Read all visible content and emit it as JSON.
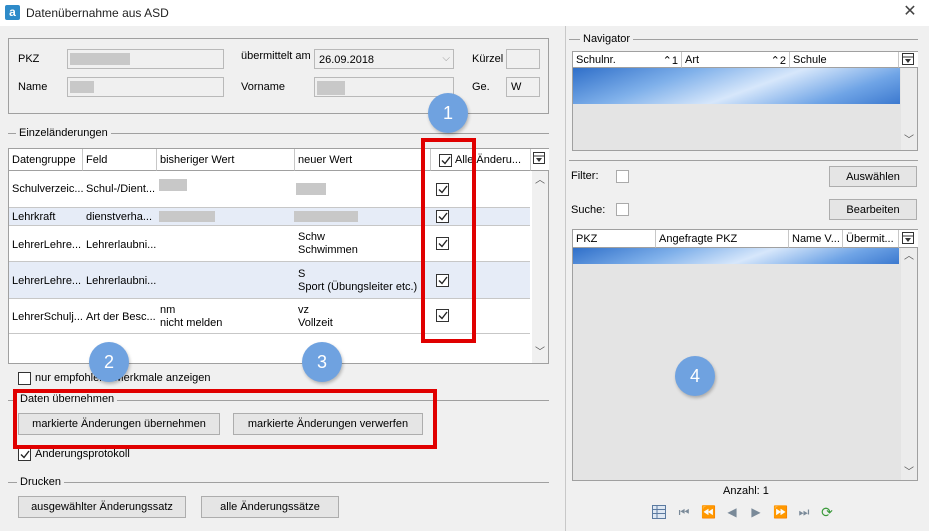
{
  "window": {
    "title": "Datenübernahme aus ASD",
    "app_icon": "a"
  },
  "person": {
    "pkz_label": "PKZ",
    "name_label": "Name",
    "uebermittelt_label": "übermittelt am",
    "uebermittelt_value": "26.09.2018",
    "vorname_label": "Vorname",
    "kuerzel_label": "Kürzel",
    "ge_label": "Ge.",
    "ge_value": "W"
  },
  "einzel": {
    "section_label": "Einzeländerungen",
    "columns": [
      "Datengruppe",
      "Feld",
      "bisheriger Wert",
      "neuer Wert",
      "Alle Änderu..."
    ],
    "rows": [
      {
        "gruppe": "Schulverzeic...",
        "feld": "Schul-/Dient...",
        "bisher1": "",
        "bisher2": "",
        "neu1": "",
        "neu2": "",
        "checked": true
      },
      {
        "gruppe": "Lehrkraft",
        "feld": "dienstverha...",
        "bisher1": "",
        "bisher2": "",
        "neu1": "",
        "neu2": "",
        "checked": true
      },
      {
        "gruppe": "LehrerLehre...",
        "feld": "Lehrerlaubni...",
        "bisher1": "",
        "bisher2": "",
        "neu1": "Schw",
        "neu2": "Schwimmen",
        "checked": true
      },
      {
        "gruppe": "LehrerLehre...",
        "feld": "Lehrerlaubni...",
        "bisher1": "",
        "bisher2": "",
        "neu1": "S",
        "neu2": "Sport (Übungsleiter etc.)",
        "checked": true
      },
      {
        "gruppe": "LehrerSchulj...",
        "feld": "Art der Besc...",
        "bisher1": "nm",
        "bisher2": "nicht melden",
        "neu1": "vz",
        "neu2": "Vollzeit",
        "checked": true
      }
    ],
    "only_recommended_label": "nur empfohlene Merkmale anzeigen"
  },
  "daten": {
    "section_label": "Daten übernehmen",
    "apply_label": "markierte Änderungen übernehmen",
    "discard_label": "markierte Änderungen verwerfen",
    "protocol_label": "Änderungsprotokoll",
    "protocol_checked": true
  },
  "drucken": {
    "section_label": "Drucken",
    "selected_label": "ausgewählter Änderungssatz",
    "all_label": "alle Änderungssätze"
  },
  "navigator": {
    "section_label": "Navigator",
    "columns": [
      "Schulnr.",
      "Art",
      "Schule"
    ],
    "sort1": "1",
    "sort2": "2",
    "filter_label": "Filter:",
    "suche_label": "Suche:",
    "auswaehlen_label": "Auswählen",
    "bearbeiten_label": "Bearbeiten",
    "list_columns": [
      "PKZ",
      "Angefragte PKZ",
      "Name V...",
      "Übermit..."
    ],
    "anzahl_label": "Anzahl: 1"
  },
  "annotations": [
    "1",
    "2",
    "3",
    "4"
  ],
  "colors": {
    "annotation_red": "#e00000",
    "badge_blue": "#6fa2e0",
    "selection_blue": "#3c79cf"
  },
  "icons": [
    "app-icon",
    "close-icon",
    "column-chooser-icon",
    "checkbox-icon",
    "scroll-up-icon",
    "scroll-down-icon",
    "table-icon",
    "first-icon",
    "prev-page-icon",
    "prev-icon",
    "next-icon",
    "next-page-icon",
    "last-icon",
    "refresh-icon"
  ]
}
